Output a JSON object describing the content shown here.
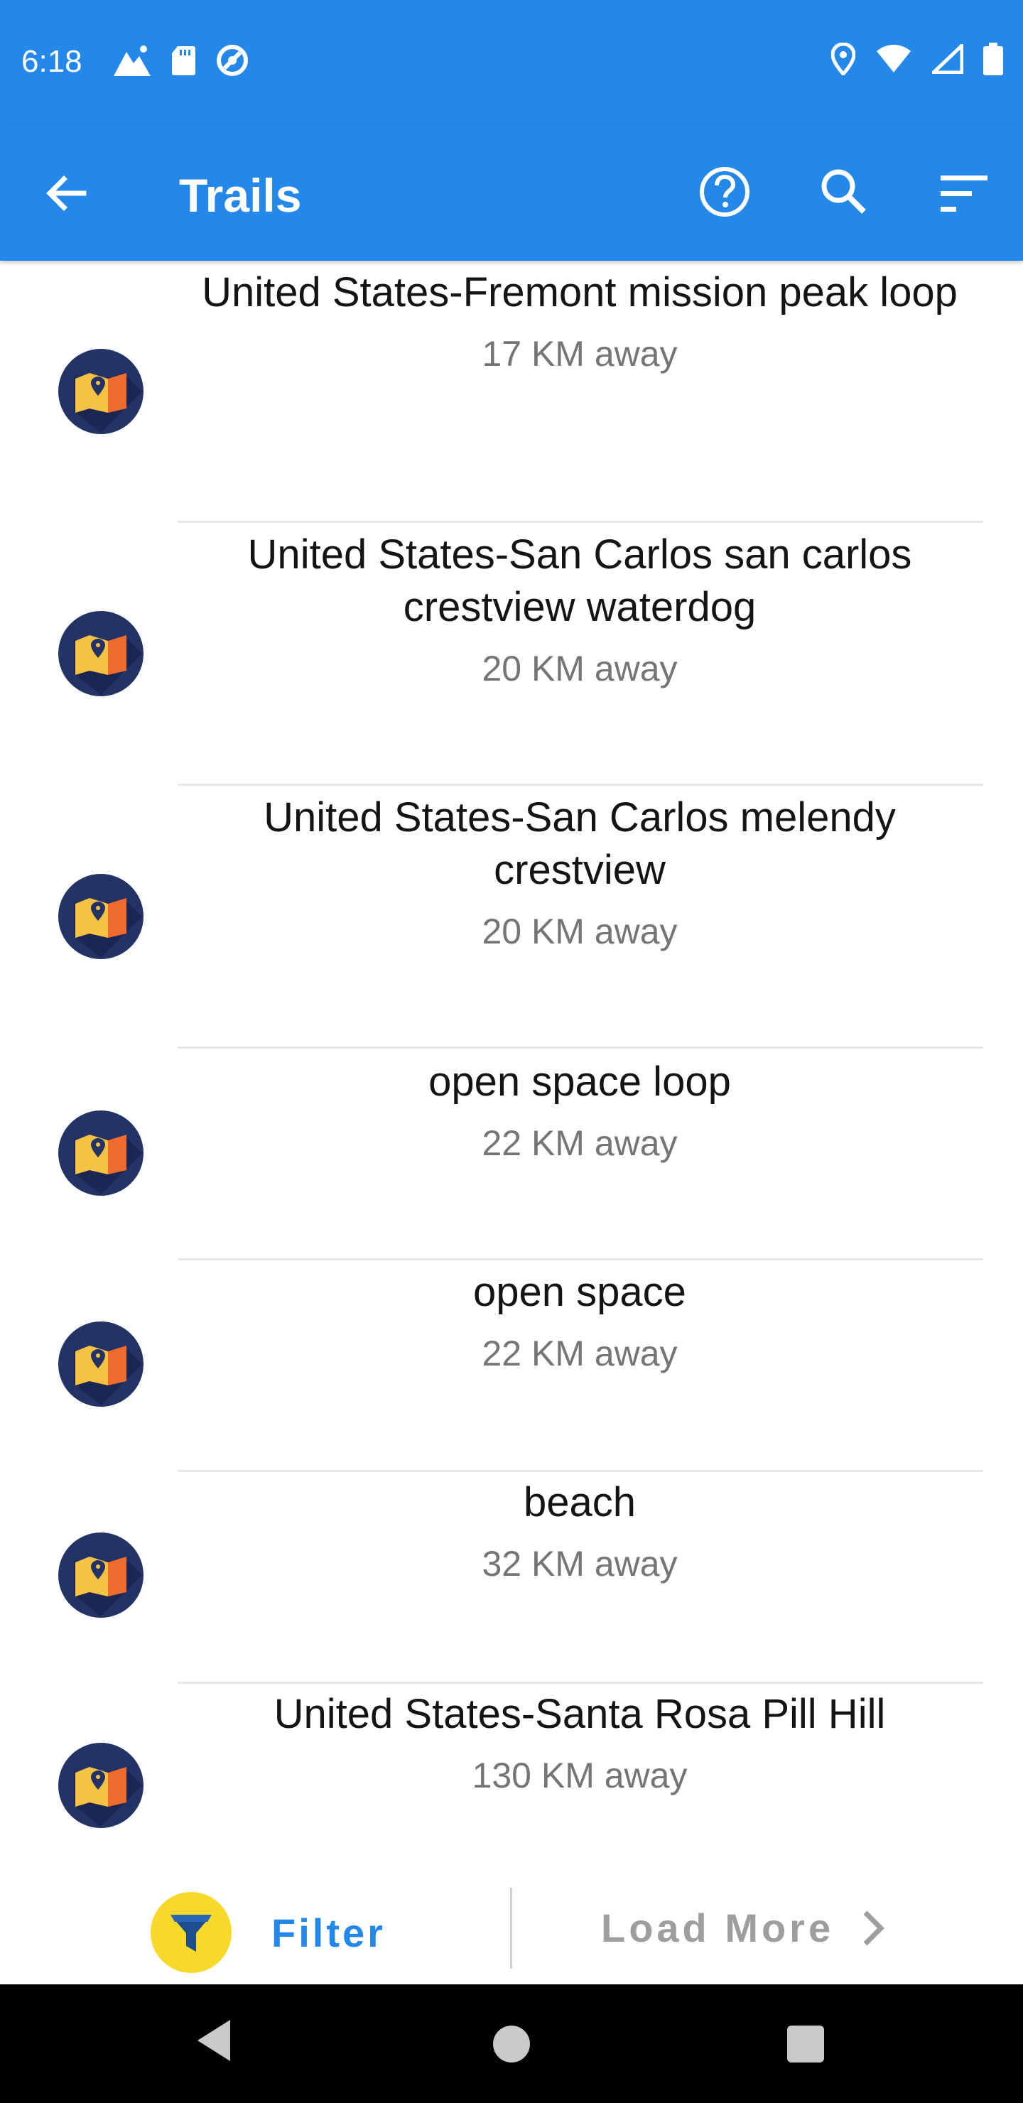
{
  "status_bar": {
    "time": "6:18"
  },
  "app_bar": {
    "title": "Trails"
  },
  "trails": [
    {
      "name": "United States-Fremont mission peak loop",
      "distance": "17 KM away"
    },
    {
      "name": "United States-San Carlos san carlos crestview waterdog",
      "distance": "20 KM away"
    },
    {
      "name": "United States-San Carlos melendy crestview",
      "distance": "20 KM away"
    },
    {
      "name": "open space loop",
      "distance": "22 KM away"
    },
    {
      "name": "open space",
      "distance": "22 KM away"
    },
    {
      "name": "beach",
      "distance": "32 KM away"
    },
    {
      "name": "United States-Santa Rosa Pill Hill",
      "distance": "130 KM away"
    }
  ],
  "bottom_bar": {
    "filter_label": "Filter",
    "load_more_label": "Load More"
  },
  "icons": {
    "status": [
      "mountain-icon",
      "sd-card-icon",
      "sync-disabled-icon",
      "location-icon",
      "wifi-icon",
      "signal-icon",
      "battery-icon"
    ],
    "app_bar": [
      "arrow-back-icon",
      "help-icon",
      "search-icon",
      "sort-icon"
    ],
    "trail": "map-icon",
    "bottom": [
      "filter-funnel-icon",
      "chevron-right-icon"
    ],
    "nav": [
      "nav-back-icon",
      "nav-home-icon",
      "nav-recents-icon"
    ]
  },
  "colors": {
    "primary": "#2487ea",
    "avatar_bg": "#243366",
    "map_yellow": "#f6c244",
    "map_orange": "#ef6a2e",
    "filter_yellow": "#f8d92a",
    "text_primary": "#141414",
    "text_secondary": "#757575",
    "disabled_text": "#9e9e9e"
  }
}
